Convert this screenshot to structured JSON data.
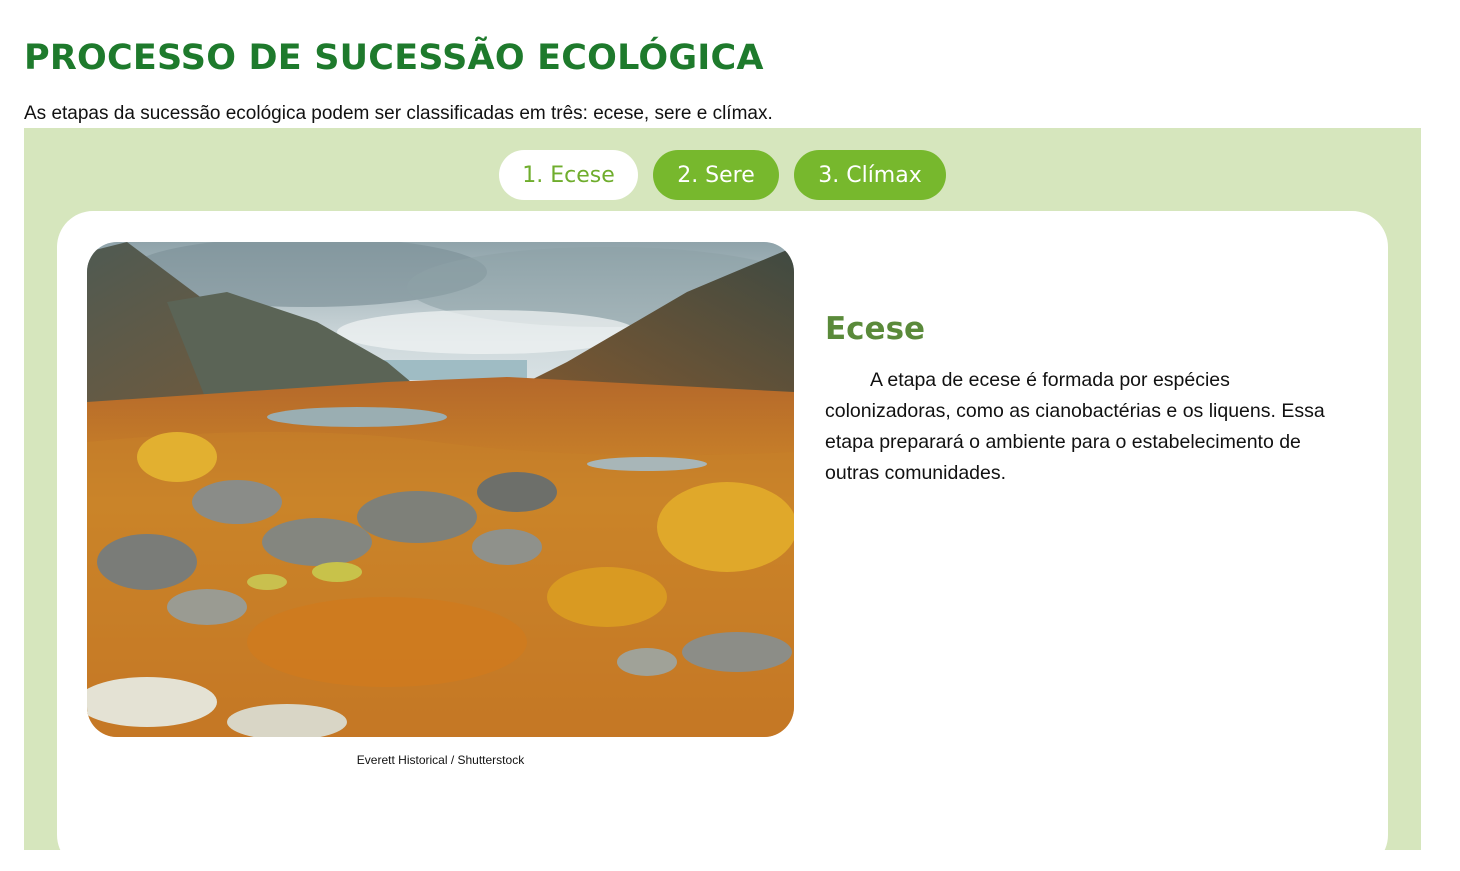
{
  "header": {
    "title": "PROCESSO DE SUCESSÃO ECOLÓGICA",
    "intro": "As etapas da sucessão ecológica podem ser classificadas em três: ecese, sere e clímax."
  },
  "tabs": [
    {
      "label": "1. Ecese",
      "active": true
    },
    {
      "label": "2. Sere",
      "active": false
    },
    {
      "label": "3. Clímax",
      "active": false
    }
  ],
  "content": {
    "image_alt": "mountain-valley-autumn-tundra-landscape",
    "credit": "Everett Historical / Shutterstock",
    "heading": "Ecese",
    "text": "A etapa de ecese é formada por espécies colonizadoras, como as cianobactérias e os liquens. Essa etapa preparará o ambiente para o estabelecimento de outras comunidades."
  },
  "colors": {
    "title_green": "#1e7a2c",
    "panel_bg": "#d6e6bd",
    "tab_green": "#77b82d",
    "heading_green": "#5a8a3a"
  }
}
